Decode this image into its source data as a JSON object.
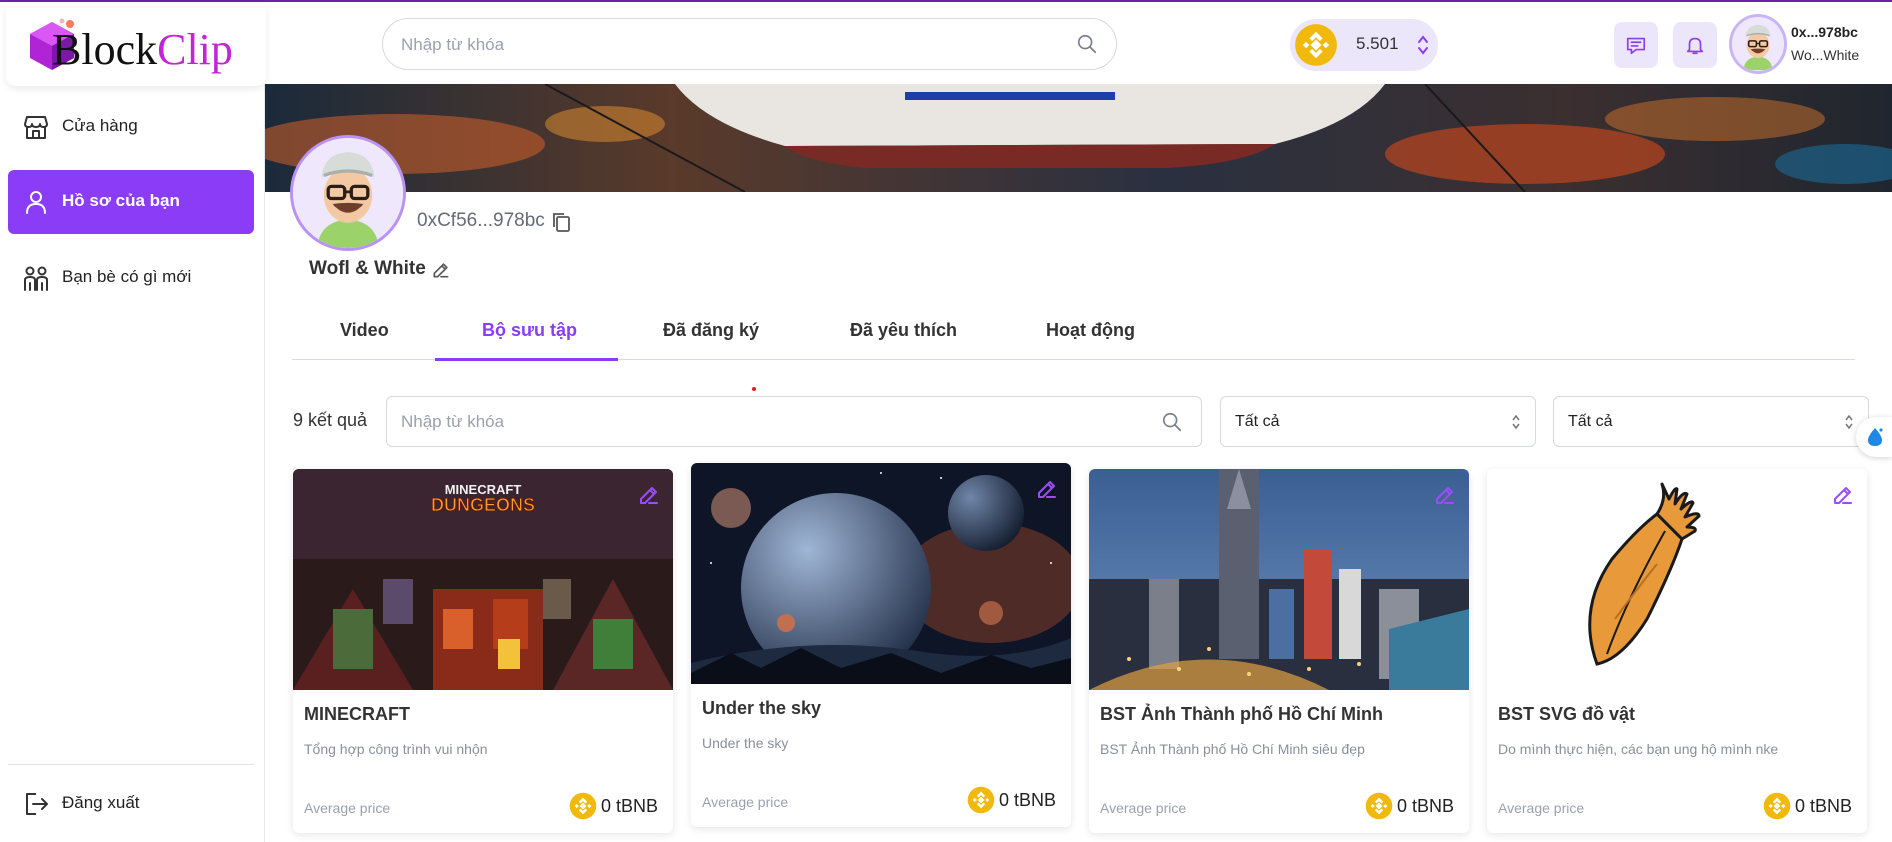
{
  "app": {
    "logo_part1": "Block",
    "logo_part2": "Clip"
  },
  "header": {
    "search_placeholder": "Nhập từ khóa",
    "wallet_balance": "5.501",
    "user_address": "0x...978bc",
    "user_name": "Wo...White",
    "icons": [
      "search-icon",
      "bnb-coin-icon",
      "chevron-up-down-icon",
      "chat-icon",
      "bell-icon"
    ]
  },
  "sidebar": {
    "items": [
      {
        "label": "Cửa hàng",
        "icon": "store-icon"
      },
      {
        "label": "Hồ sơ của bạn",
        "icon": "user-icon"
      },
      {
        "label": "Bạn bè có gì mới",
        "icon": "users-icon"
      }
    ],
    "logout_label": "Đăng xuất"
  },
  "profile": {
    "wallet_address": "0xCf56...978bc",
    "name": "Wofl & White"
  },
  "tabs": [
    {
      "label": "Video"
    },
    {
      "label": "Bộ sưu tập"
    },
    {
      "label": "Đã đăng ký"
    },
    {
      "label": "Đã yêu thích"
    },
    {
      "label": "Hoạt động"
    }
  ],
  "active_tab": "Bộ sưu tập",
  "filters": {
    "results": "9 kết quả",
    "search_placeholder": "Nhập từ khóa",
    "select1_value": "Tất cả",
    "select2_value": "Tất cả"
  },
  "collections": [
    {
      "title": "MINECRAFT",
      "description": "Tổng hợp công trình vui nhộn",
      "price_label": "Average price",
      "price": "0 tBNB",
      "thumb_text": "MINECRAFT DUNGEONS"
    },
    {
      "title": "Under the sky",
      "description": "Under the sky",
      "price_label": "Average price",
      "price": "0 tBNB"
    },
    {
      "title": "BST Ảnh Thành phố Hồ Chí Minh",
      "description": "BST Ảnh Thành phố Hồ Chí Minh siêu đẹp",
      "price_label": "Average price",
      "price": "0 tBNB"
    },
    {
      "title": "BST SVG đồ vật",
      "description": "Do mình thực hiện, các bạn ung hộ mình nke",
      "price_label": "Average price",
      "price": "0 tBNB"
    }
  ],
  "colors": {
    "accent": "#8b3cf7",
    "accent_light": "#ece6fb",
    "bnb": "#f0b90b",
    "logo_pink": "#c026d3"
  }
}
